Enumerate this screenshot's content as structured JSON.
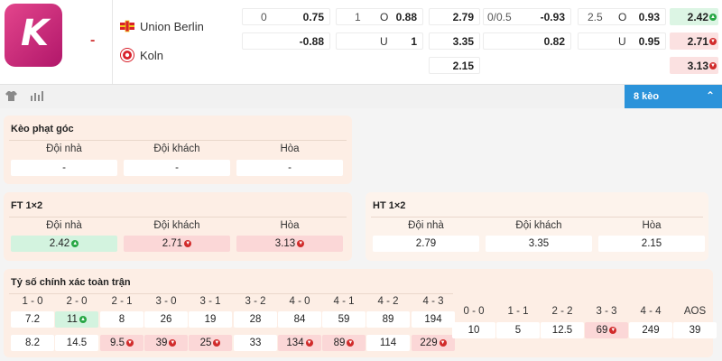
{
  "match": {
    "separator": "-",
    "home_team": "Union Berlin",
    "away_team": "Koln",
    "odds_rows": [
      {
        "hdp": {
          "line": "0",
          "value": "0.75"
        },
        "ou": {
          "line": "1",
          "side": "O",
          "value": "0.88"
        },
        "x12": "2.79",
        "hdp_half": {
          "line": "0/0.5",
          "value": "-0.93"
        },
        "ou_half": {
          "line": "2.5",
          "side": "O",
          "value": "0.93"
        },
        "x12_half": "2.42"
      },
      {
        "hdp": {
          "line": "",
          "value": "-0.88"
        },
        "ou": {
          "line": "",
          "side": "U",
          "value": "1"
        },
        "x12": "3.35",
        "hdp_half": {
          "line": "",
          "value": "0.82"
        },
        "ou_half": {
          "line": "",
          "side": "U",
          "value": "0.95"
        },
        "x12_half": "2.71"
      },
      {
        "x12": "2.15",
        "x12_half": "3.13"
      }
    ]
  },
  "toolbar": {
    "shirt_icon": "shirt-icon",
    "stats_icon": "stats-icon",
    "keo_label": "8 kèo",
    "chevron": "chevron-up-icon"
  },
  "corner": {
    "title": "Kèo phạt góc",
    "headers": [
      "Đội nhà",
      "Đội khách",
      "Hòa"
    ],
    "values": [
      "-",
      "-",
      "-"
    ]
  },
  "ft": {
    "title": "FT 1×2",
    "headers": [
      "Đội nhà",
      "Đội khách",
      "Hòa"
    ],
    "values": [
      "2.42",
      "2.71",
      "3.13"
    ],
    "trends": [
      "up",
      "down",
      "down"
    ]
  },
  "ht": {
    "title": "HT 1×2",
    "headers": [
      "Đội nhà",
      "Đội khách",
      "Hòa"
    ],
    "values": [
      "2.79",
      "3.35",
      "2.15"
    ]
  },
  "correct_score": {
    "title": "Tỷ số chính xác toàn trận",
    "left_headers": [
      "1 - 0",
      "2 - 0",
      "2 - 1",
      "3 - 0",
      "3 - 1",
      "3 - 2",
      "4 - 0",
      "4 - 1",
      "4 - 2",
      "4 - 3"
    ],
    "left_row1": [
      {
        "v": "7.2",
        "t": ""
      },
      {
        "v": "11",
        "t": "up"
      },
      {
        "v": "8",
        "t": ""
      },
      {
        "v": "26",
        "t": ""
      },
      {
        "v": "19",
        "t": ""
      },
      {
        "v": "28",
        "t": ""
      },
      {
        "v": "84",
        "t": ""
      },
      {
        "v": "59",
        "t": ""
      },
      {
        "v": "89",
        "t": ""
      },
      {
        "v": "194",
        "t": ""
      }
    ],
    "left_row2": [
      {
        "v": "8.2",
        "t": ""
      },
      {
        "v": "14.5",
        "t": ""
      },
      {
        "v": "9.5",
        "t": "down"
      },
      {
        "v": "39",
        "t": "down"
      },
      {
        "v": "25",
        "t": "down"
      },
      {
        "v": "33",
        "t": ""
      },
      {
        "v": "134",
        "t": "down"
      },
      {
        "v": "89",
        "t": "down"
      },
      {
        "v": "114",
        "t": ""
      },
      {
        "v": "229",
        "t": "down"
      }
    ],
    "right_headers": [
      "0 - 0",
      "1 - 1",
      "2 - 2",
      "3 - 3",
      "4 - 4",
      "AOS"
    ],
    "right_row": [
      {
        "v": "10",
        "t": ""
      },
      {
        "v": "5",
        "t": ""
      },
      {
        "v": "12.5",
        "t": ""
      },
      {
        "v": "69",
        "t": "down"
      },
      {
        "v": "249",
        "t": ""
      },
      {
        "v": "39",
        "t": ""
      }
    ]
  }
}
